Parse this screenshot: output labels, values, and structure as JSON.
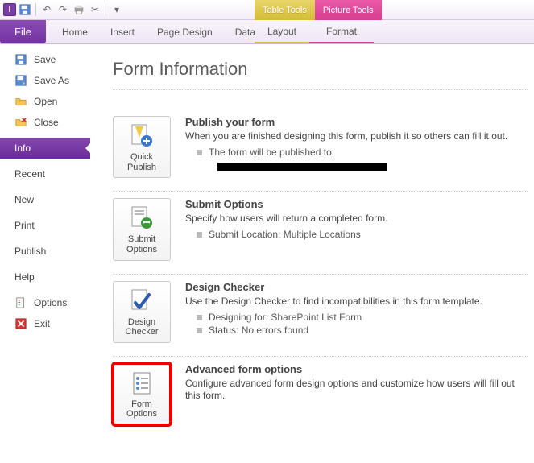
{
  "qat": {
    "app_glyph": "I"
  },
  "context_tabs": {
    "table": {
      "label": "Table Tools",
      "sub": "Layout"
    },
    "picture": {
      "label": "Picture Tools",
      "sub": "Format"
    }
  },
  "ribbon": {
    "file": "File",
    "tabs": [
      "Home",
      "Insert",
      "Page Design",
      "Data"
    ]
  },
  "sidebar": {
    "save": "Save",
    "save_as": "Save As",
    "open": "Open",
    "close": "Close",
    "info": "Info",
    "recent": "Recent",
    "new": "New",
    "print": "Print",
    "publish": "Publish",
    "help": "Help",
    "options": "Options",
    "exit": "Exit"
  },
  "page": {
    "title": "Form Information",
    "sections": {
      "publish": {
        "button": "Quick Publish",
        "title": "Publish your form",
        "desc": "When you are finished designing this form, publish it so others can fill it out.",
        "bullet": "The form will be published to:"
      },
      "submit": {
        "button": "Submit Options",
        "title": "Submit Options",
        "desc": "Specify how users will return a completed form.",
        "bullet": "Submit Location: Multiple Locations"
      },
      "checker": {
        "button": "Design Checker",
        "title": "Design Checker",
        "desc": "Use the Design Checker to find incompatibilities in this form template.",
        "bullet1": "Designing for: SharePoint List Form",
        "bullet2": "Status: No errors found"
      },
      "advanced": {
        "button": "Form Options",
        "title": "Advanced form options",
        "desc": "Configure advanced form design options and customize how users will fill out this form."
      }
    }
  }
}
